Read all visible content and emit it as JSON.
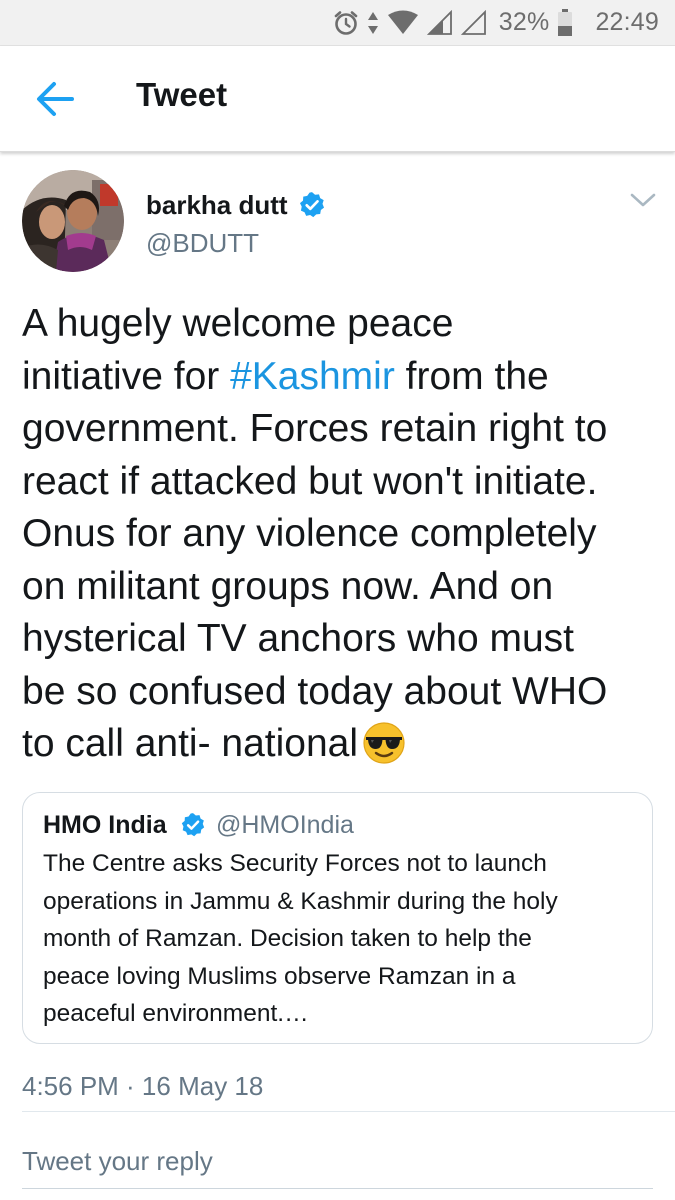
{
  "status_bar": {
    "battery_percent": "32%",
    "time": "22:49",
    "icons": [
      "alarm-icon",
      "data-arrows-icon",
      "wifi-icon",
      "signal-icon",
      "signal-empty-icon",
      "battery-icon"
    ]
  },
  "app_bar": {
    "title": "Tweet",
    "back_icon": "back-arrow-icon"
  },
  "tweet": {
    "author_name": "barkha dutt",
    "handle": "@BDUTT",
    "verified": true,
    "text_lines": [
      "A hugely welcome peace",
      [
        "initiative for ",
        "#Kashmir",
        " from the"
      ],
      "government. Forces retain right to",
      "react if attacked but won't initiate.",
      "Onus for any violence completely",
      "on militant groups now. And on",
      "hysterical TV anchors who must",
      "be so confused today about WHO",
      "to call anti- national"
    ],
    "emoji": "smiling-face-with-sunglasses",
    "timestamp": "4:56 PM · 16 May 18"
  },
  "quote": {
    "name": "HMO India",
    "handle": "@HMOIndia",
    "verified": true,
    "text_lines": [
      "The Centre asks Security Forces not to launch",
      "operations in Jammu & Kashmir during the holy",
      "month of Ramzan. Decision taken to help the",
      "peace loving Muslims observe Ramzan in a",
      "peaceful environment.…"
    ]
  },
  "reply": {
    "placeholder": "Tweet your reply",
    "value": ""
  },
  "colors": {
    "link": "#1b95e0",
    "verified": "#1da1f2",
    "secondary_text": "#657786",
    "primary_text": "#14171a"
  }
}
